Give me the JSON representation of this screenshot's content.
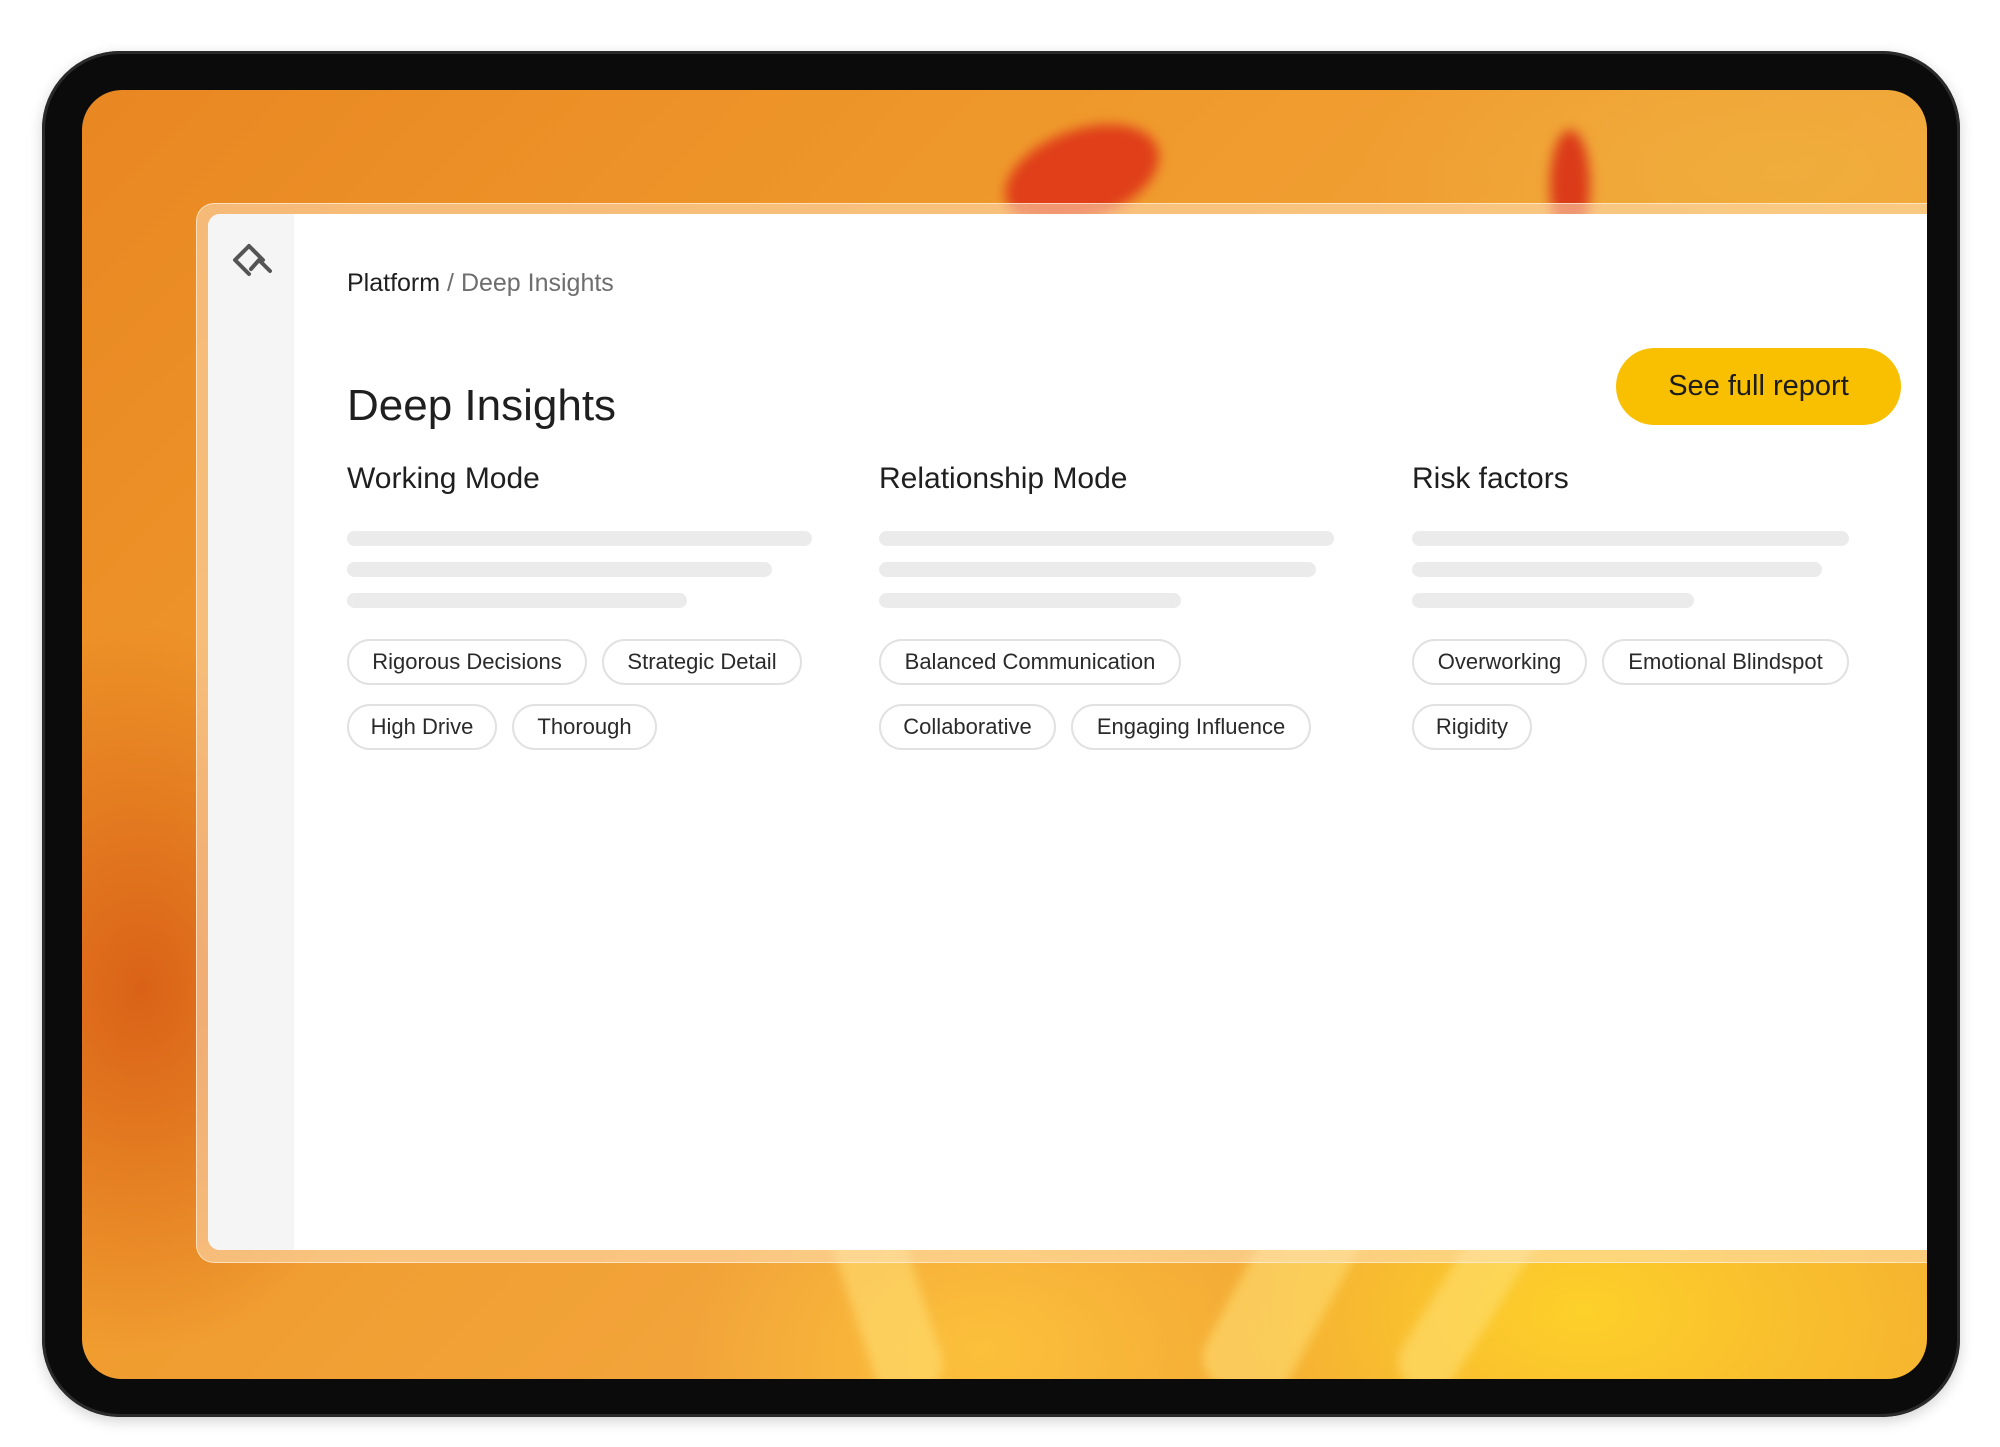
{
  "breadcrumb": {
    "root": "Platform",
    "separator": " / ",
    "current": "Deep Insights"
  },
  "page_title": "Deep Insights",
  "cta_label": "See full report",
  "sections": [
    {
      "title": "Working Mode",
      "tags": [
        "Rigorous Decisions",
        "Strategic Detail",
        "High Drive",
        "Thorough"
      ]
    },
    {
      "title": "Relationship Mode",
      "tags": [
        "Balanced Communication",
        "Collaborative",
        "Engaging Influence"
      ]
    },
    {
      "title": "Risk factors",
      "tags": [
        "Overworking",
        "Emotional Blindspot",
        "Rigidity"
      ]
    }
  ],
  "colors": {
    "accent": "#f8c000",
    "sidebar_bg": "#f5f5f5",
    "skeleton": "#ebebeb",
    "device_bezel": "#0b0b0b"
  },
  "icons": {
    "logo": "diamond-logo-icon"
  }
}
